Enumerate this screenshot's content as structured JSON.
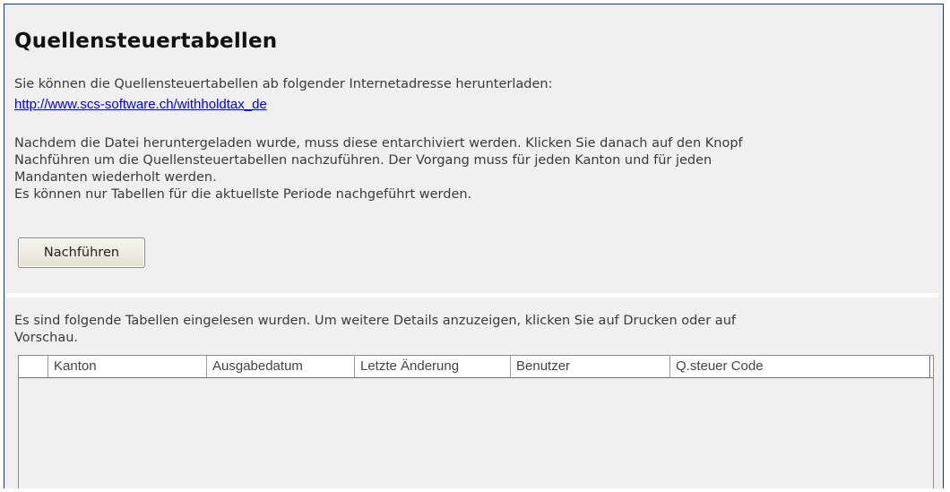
{
  "page": {
    "title": "Quellensteuertabellen",
    "intro": "Sie können die Quellensteuertabellen ab folgender Internetadresse herunterladen:",
    "link": "http://www.scs-software.ch/withholdtax_de",
    "description_lines": [
      "Nachdem die Datei heruntergeladen wurde, muss diese entarchiviert werden. Klicken Sie danach auf den Knopf",
      "Nachführen um die Quellensteuertabellen nachzuführen. Der Vorgang muss für jeden Kanton und für jeden",
      "Mandanten wiederholt werden.",
      "Es können nur Tabellen für die aktuellste Periode nachgeführt werden."
    ],
    "update_button_label": "Nachführen",
    "tables_info_lines": [
      "Es sind folgende Tabellen eingelesen wurden. Um weitere Details anzuzeigen, klicken Sie auf Drucken oder auf",
      "Vorschau."
    ]
  },
  "table": {
    "columns": [
      "",
      "Kanton",
      "Ausgabedatum",
      "Letzte Änderung",
      "Benutzer",
      "Q.steuer Code"
    ],
    "rows": []
  }
}
